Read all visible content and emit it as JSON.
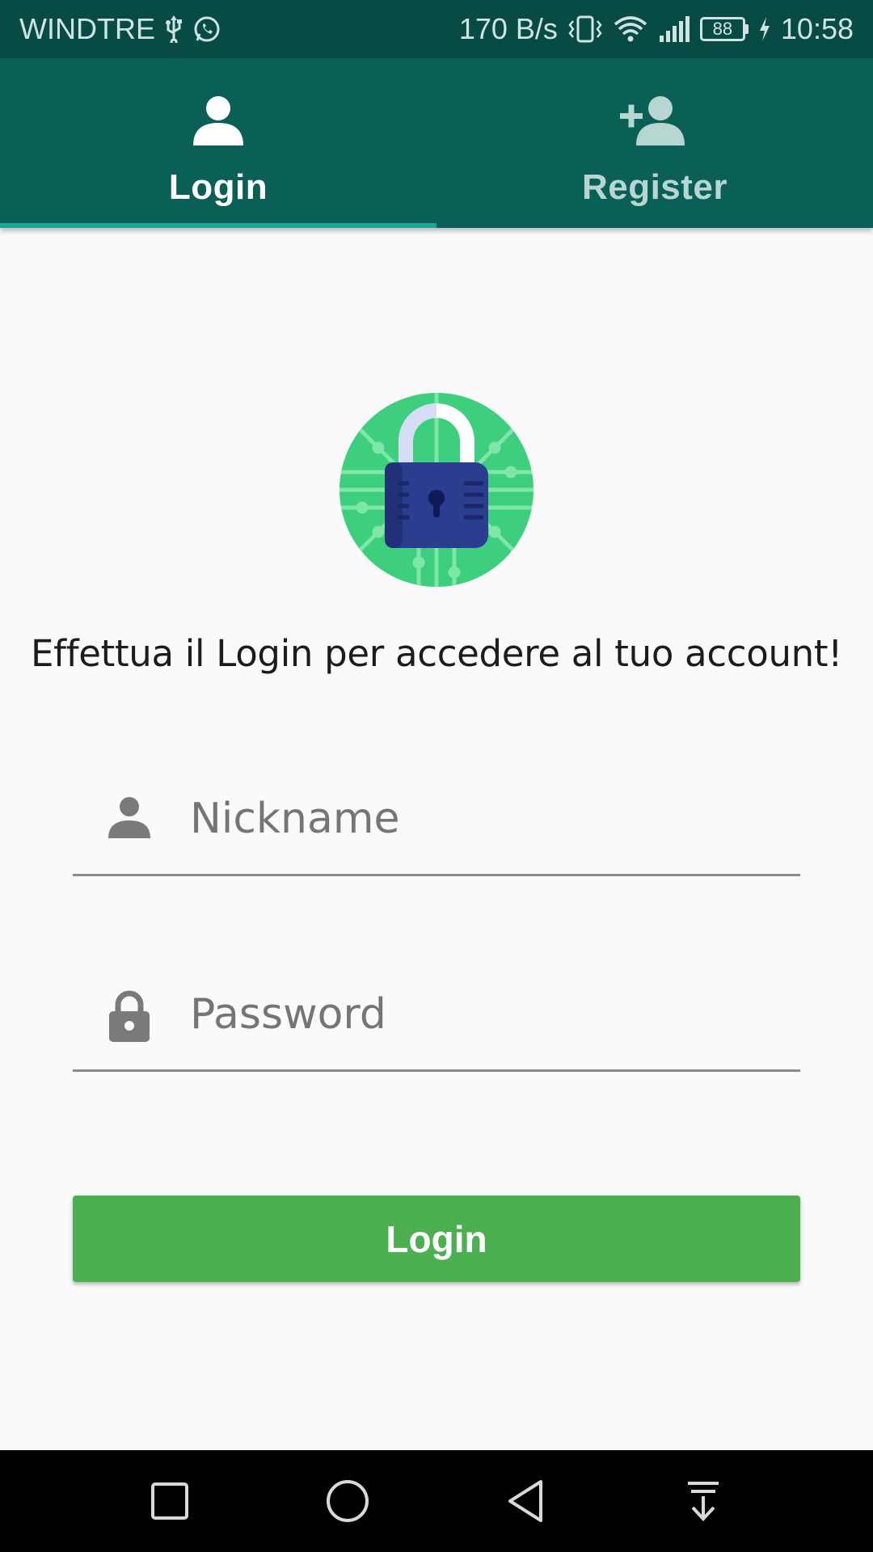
{
  "status_bar": {
    "carrier": "WINDTRE",
    "net_speed": "170 B/s",
    "battery": "88",
    "time": "10:58"
  },
  "tabs": [
    {
      "label": "Login",
      "icon": "person-icon",
      "active": true
    },
    {
      "label": "Register",
      "icon": "person-add-icon",
      "active": false
    }
  ],
  "main": {
    "logo_icon": "padlock-circuit-logo",
    "prompt": "Effettua il Login per accedere al tuo account!",
    "nickname_placeholder": "Nickname",
    "password_placeholder": "Password",
    "login_button": "Login"
  },
  "colors": {
    "status_bar": "#074b44",
    "tab_bar": "#0a5f56",
    "tab_indicator": "#1fa396",
    "button": "#4caf50",
    "background": "#fafafa"
  },
  "nav_bar": [
    "recents-square-icon",
    "home-circle-icon",
    "back-triangle-icon",
    "notifications-pull-icon"
  ]
}
